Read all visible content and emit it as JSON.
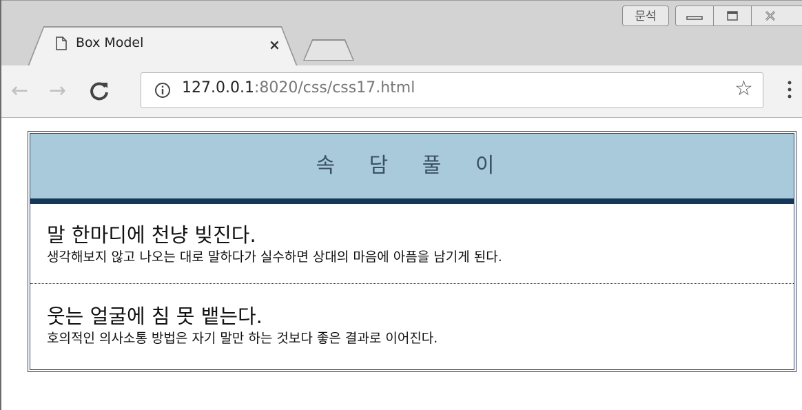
{
  "browser": {
    "tab": {
      "title": "Box Model",
      "close_label": "×"
    },
    "ime_label": "문석",
    "address": {
      "host": "127.0.0.1",
      "path": ":8020/css/css17.html"
    }
  },
  "page": {
    "header": {
      "title": "속 담 풀 이"
    },
    "items": [
      {
        "proverb": "말 한마디에 천냥 빚진다.",
        "meaning": "생각해보지 않고 나오는 대로 말하다가 실수하면 상대의 마음에 아픔을 남기게 된다."
      },
      {
        "proverb": "웃는 얼굴에 침 못 뱉는다.",
        "meaning": "호의적인 의사소통 방법은 자기 말만 하는 것보다 좋은 결과로 이어진다."
      }
    ]
  },
  "colors": {
    "header_bg": "#a8cadb",
    "header_border": "#14375a",
    "box_border": "#2f3f5f"
  }
}
